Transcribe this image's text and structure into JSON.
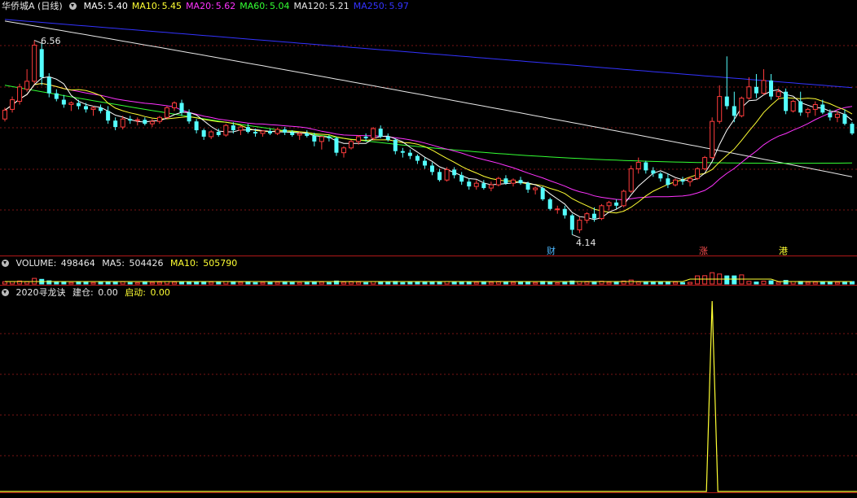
{
  "header": {
    "stock_title": "华侨城A (日线)",
    "ma": [
      {
        "label": "MA5:",
        "value": "5.40",
        "color": "#ffffff"
      },
      {
        "label": "MA10:",
        "value": "5.45",
        "color": "#ffff33"
      },
      {
        "label": "MA20:",
        "value": "5.62",
        "color": "#ff33ff"
      },
      {
        "label": "MA60:",
        "value": "5.04",
        "color": "#33ff33"
      },
      {
        "label": "MA120:",
        "value": "5.21",
        "color": "#e8e8e8"
      },
      {
        "label": "MA250:",
        "value": "5.97",
        "color": "#3333ff"
      }
    ]
  },
  "volume_header": {
    "title": "VOLUME:",
    "value": "498464",
    "ma5_label": "MA5:",
    "ma5_value": "504426",
    "ma10_label": "MA10:",
    "ma10_value": "505790"
  },
  "indicator_header": {
    "title": "2020寻龙诀",
    "build_label": "建仓:",
    "build_value": "0.00",
    "start_label": "启动:",
    "start_value": "0.00"
  },
  "annotations": {
    "high_label": "6.56",
    "low_label": "4.14",
    "marks": [
      "财",
      "涨",
      "港"
    ]
  },
  "chart_data": {
    "type": "candlestick",
    "high": 6.56,
    "low": 4.14,
    "ylim": [
      3.9,
      6.9
    ],
    "ma_last": {
      "MA5": 5.4,
      "MA10": 5.45,
      "MA20": 5.62,
      "MA60": 5.04,
      "MA120": 5.21,
      "MA250": 5.97
    },
    "ohlc": [
      [
        5.58,
        5.72,
        5.55,
        5.69
      ],
      [
        5.7,
        5.86,
        5.66,
        5.82
      ],
      [
        5.8,
        6.02,
        5.76,
        5.98
      ],
      [
        5.95,
        6.2,
        5.92,
        6.05
      ],
      [
        6.05,
        6.56,
        6.02,
        6.5
      ],
      [
        6.45,
        6.52,
        6.0,
        6.1
      ],
      [
        6.1,
        6.15,
        5.85,
        5.9
      ],
      [
        5.9,
        5.95,
        5.8,
        5.83
      ],
      [
        5.82,
        5.88,
        5.72,
        5.76
      ],
      [
        5.76,
        5.8,
        5.68,
        5.78
      ],
      [
        5.78,
        5.82,
        5.7,
        5.74
      ],
      [
        5.74,
        5.78,
        5.66,
        5.7
      ],
      [
        5.7,
        5.74,
        5.62,
        5.72
      ],
      [
        5.72,
        5.76,
        5.65,
        5.68
      ],
      [
        5.68,
        5.74,
        5.52,
        5.56
      ],
      [
        5.56,
        5.6,
        5.44,
        5.48
      ],
      [
        5.48,
        5.62,
        5.45,
        5.58
      ],
      [
        5.58,
        5.62,
        5.52,
        5.56
      ],
      [
        5.56,
        5.6,
        5.5,
        5.57
      ],
      [
        5.57,
        5.6,
        5.5,
        5.52
      ],
      [
        5.52,
        5.58,
        5.48,
        5.55
      ],
      [
        5.55,
        5.62,
        5.52,
        5.6
      ],
      [
        5.6,
        5.74,
        5.58,
        5.72
      ],
      [
        5.72,
        5.8,
        5.68,
        5.78
      ],
      [
        5.78,
        5.82,
        5.62,
        5.66
      ],
      [
        5.66,
        5.7,
        5.52,
        5.55
      ],
      [
        5.55,
        5.58,
        5.4,
        5.44
      ],
      [
        5.44,
        5.46,
        5.32,
        5.36
      ],
      [
        5.36,
        5.44,
        5.33,
        5.42
      ],
      [
        5.42,
        5.46,
        5.36,
        5.38
      ],
      [
        5.38,
        5.52,
        5.36,
        5.5
      ],
      [
        5.5,
        5.54,
        5.4,
        5.44
      ],
      [
        5.44,
        5.5,
        5.38,
        5.48
      ],
      [
        5.48,
        5.52,
        5.4,
        5.42
      ],
      [
        5.42,
        5.46,
        5.36,
        5.4
      ],
      [
        5.4,
        5.44,
        5.36,
        5.43
      ],
      [
        5.43,
        5.46,
        5.38,
        5.4
      ],
      [
        5.4,
        5.47,
        5.38,
        5.45
      ],
      [
        5.45,
        5.48,
        5.38,
        5.41
      ],
      [
        5.41,
        5.44,
        5.36,
        5.38
      ],
      [
        5.38,
        5.42,
        5.32,
        5.4
      ],
      [
        5.4,
        5.44,
        5.35,
        5.37
      ],
      [
        5.37,
        5.41,
        5.24,
        5.3
      ],
      [
        5.3,
        5.34,
        5.2,
        5.36
      ],
      [
        5.36,
        5.38,
        5.3,
        5.34
      ],
      [
        5.34,
        5.36,
        5.12,
        5.16
      ],
      [
        5.16,
        5.24,
        5.1,
        5.22
      ],
      [
        5.22,
        5.32,
        5.2,
        5.3
      ],
      [
        5.3,
        5.38,
        5.26,
        5.36
      ],
      [
        5.36,
        5.4,
        5.3,
        5.34
      ],
      [
        5.34,
        5.48,
        5.32,
        5.46
      ],
      [
        5.46,
        5.5,
        5.34,
        5.36
      ],
      [
        5.36,
        5.4,
        5.3,
        5.32
      ],
      [
        5.32,
        5.34,
        5.14,
        5.18
      ],
      [
        5.18,
        5.22,
        5.1,
        5.16
      ],
      [
        5.16,
        5.2,
        5.08,
        5.12
      ],
      [
        5.12,
        5.14,
        5.02,
        5.06
      ],
      [
        5.06,
        5.1,
        4.96,
        5.0
      ],
      [
        5.0,
        5.04,
        4.88,
        4.92
      ],
      [
        4.92,
        4.96,
        4.8,
        4.82
      ],
      [
        4.82,
        4.98,
        4.8,
        4.95
      ],
      [
        4.95,
        4.98,
        4.84,
        4.88
      ],
      [
        4.88,
        4.92,
        4.76,
        4.8
      ],
      [
        4.8,
        4.84,
        4.7,
        4.74
      ],
      [
        4.74,
        4.82,
        4.7,
        4.78
      ],
      [
        4.78,
        4.82,
        4.7,
        4.72
      ],
      [
        4.72,
        4.8,
        4.68,
        4.76
      ],
      [
        4.76,
        4.86,
        4.74,
        4.84
      ],
      [
        4.84,
        4.88,
        4.76,
        4.78
      ],
      [
        4.78,
        4.84,
        4.74,
        4.82
      ],
      [
        4.82,
        4.86,
        4.76,
        4.78
      ],
      [
        4.78,
        4.8,
        4.66,
        4.7
      ],
      [
        4.7,
        4.74,
        4.64,
        4.72
      ],
      [
        4.72,
        4.74,
        4.56,
        4.58
      ],
      [
        4.58,
        4.6,
        4.44,
        4.46
      ],
      [
        4.46,
        4.5,
        4.4,
        4.46
      ],
      [
        4.46,
        4.5,
        4.34,
        4.38
      ],
      [
        4.38,
        4.4,
        4.14,
        4.2
      ],
      [
        4.2,
        4.36,
        4.16,
        4.32
      ],
      [
        4.32,
        4.42,
        4.28,
        4.4
      ],
      [
        4.4,
        4.48,
        4.3,
        4.34
      ],
      [
        4.34,
        4.52,
        4.32,
        4.5
      ],
      [
        4.5,
        4.56,
        4.44,
        4.54
      ],
      [
        4.54,
        4.58,
        4.46,
        4.5
      ],
      [
        4.5,
        4.7,
        4.48,
        4.68
      ],
      [
        4.68,
        5.0,
        4.66,
        4.96
      ],
      [
        4.96,
        5.1,
        4.9,
        5.04
      ],
      [
        5.04,
        5.06,
        4.9,
        4.94
      ],
      [
        4.94,
        4.98,
        4.86,
        4.9
      ],
      [
        4.9,
        4.92,
        4.8,
        4.84
      ],
      [
        4.84,
        4.9,
        4.72,
        4.76
      ],
      [
        4.76,
        4.84,
        4.74,
        4.82
      ],
      [
        4.82,
        4.86,
        4.76,
        4.8
      ],
      [
        4.8,
        4.86,
        4.74,
        4.84
      ],
      [
        4.84,
        4.98,
        4.82,
        4.96
      ],
      [
        4.96,
        5.12,
        4.94,
        5.1
      ],
      [
        5.1,
        5.6,
        5.08,
        5.55
      ],
      [
        5.55,
        6.0,
        5.52,
        5.86
      ],
      [
        5.86,
        6.36,
        5.7,
        5.74
      ],
      [
        5.74,
        5.92,
        5.54,
        5.62
      ],
      [
        5.62,
        5.86,
        5.6,
        5.84
      ],
      [
        5.84,
        6.1,
        5.82,
        5.98
      ],
      [
        5.98,
        6.14,
        5.84,
        5.9
      ],
      [
        5.9,
        6.2,
        5.88,
        6.06
      ],
      [
        6.06,
        6.14,
        5.82,
        5.86
      ],
      [
        5.86,
        5.96,
        5.82,
        5.92
      ],
      [
        5.92,
        5.96,
        5.64,
        5.68
      ],
      [
        5.68,
        5.82,
        5.66,
        5.8
      ],
      [
        5.8,
        5.92,
        5.62,
        5.66
      ],
      [
        5.66,
        5.72,
        5.6,
        5.7
      ],
      [
        5.7,
        5.8,
        5.62,
        5.76
      ],
      [
        5.76,
        5.82,
        5.64,
        5.66
      ],
      [
        5.66,
        5.7,
        5.56,
        5.6
      ],
      [
        5.6,
        5.68,
        5.54,
        5.64
      ],
      [
        5.64,
        5.7,
        5.5,
        5.52
      ],
      [
        5.52,
        5.54,
        5.38,
        5.4
      ]
    ]
  }
}
